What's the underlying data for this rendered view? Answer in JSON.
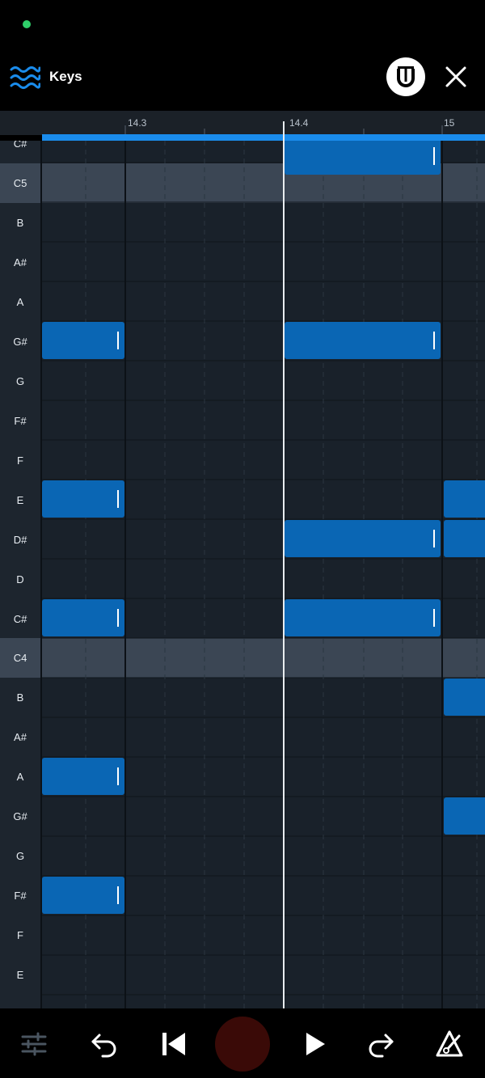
{
  "header": {
    "track_title": "Keys",
    "icon": "waves-icon",
    "snap_icon": "magnet-icon",
    "close_icon": "close-icon"
  },
  "ruler": {
    "ticks": [
      "14.3",
      "14.4",
      "15"
    ]
  },
  "keys": [
    "C#",
    "C5",
    "B",
    "A#",
    "A",
    "G#",
    "G",
    "F#",
    "F",
    "E",
    "D#",
    "D",
    "C#",
    "C4",
    "B",
    "A#",
    "A",
    "G#",
    "G",
    "F#",
    "F",
    "E"
  ],
  "toolbar": {
    "mixer_icon": "sliders-icon",
    "undo_icon": "undo-icon",
    "rewind_icon": "skip-back-icon",
    "record_icon": "record-icon",
    "play_icon": "play-icon",
    "redo_icon": "redo-icon",
    "metronome_icon": "metronome-icon"
  },
  "colors": {
    "accent": "#1a8cec",
    "note": "#0a66b4",
    "record": "#3a0a07",
    "grid_bg": "#19212a",
    "c_row": "#3b4654",
    "status_dot": "#2fcf6a"
  }
}
